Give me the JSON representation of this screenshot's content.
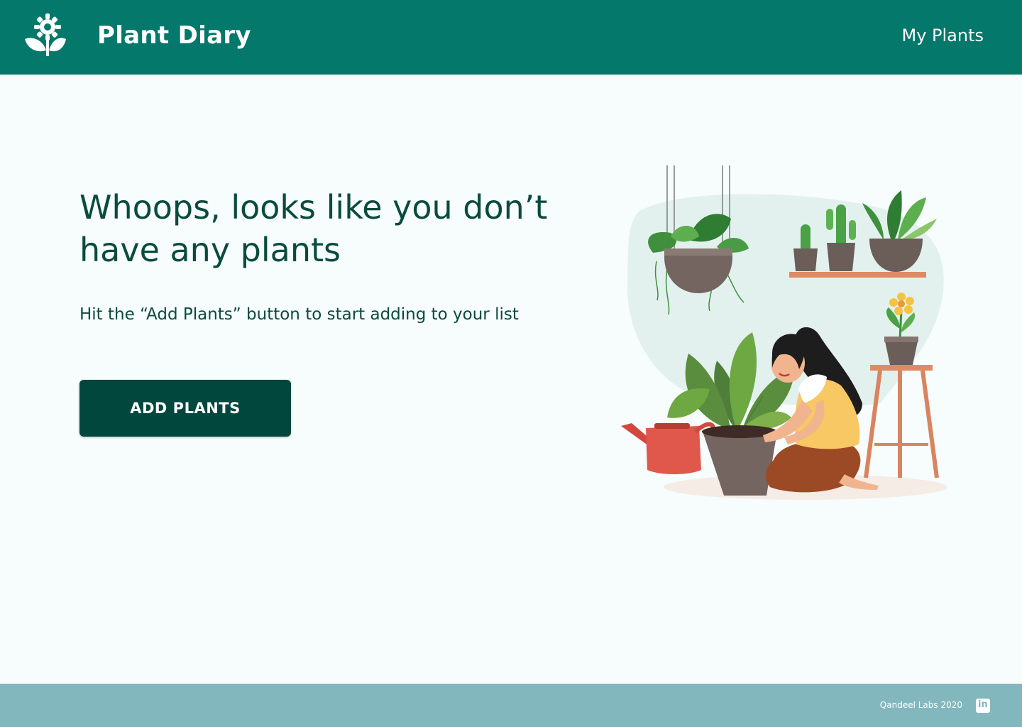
{
  "header": {
    "brand": "Plant Diary",
    "nav_link": "My Plants"
  },
  "main": {
    "headline": "Whoops, looks like you don’t have any plants",
    "subtext": "Hit the “Add Plants” button to start adding to your list",
    "cta_label": "ADD PLANTS"
  },
  "footer": {
    "credit": "Qandeel Labs 2020",
    "linkedin_label": "in"
  },
  "colors": {
    "header_bg": "#03786b",
    "footer_bg": "#82b8bd",
    "page_bg": "#f6fdfc",
    "text_dark": "#0b4a3f",
    "button_bg": "#02473d"
  },
  "icons": {
    "logo": "flower-sprout-icon",
    "social": "linkedin-icon"
  }
}
